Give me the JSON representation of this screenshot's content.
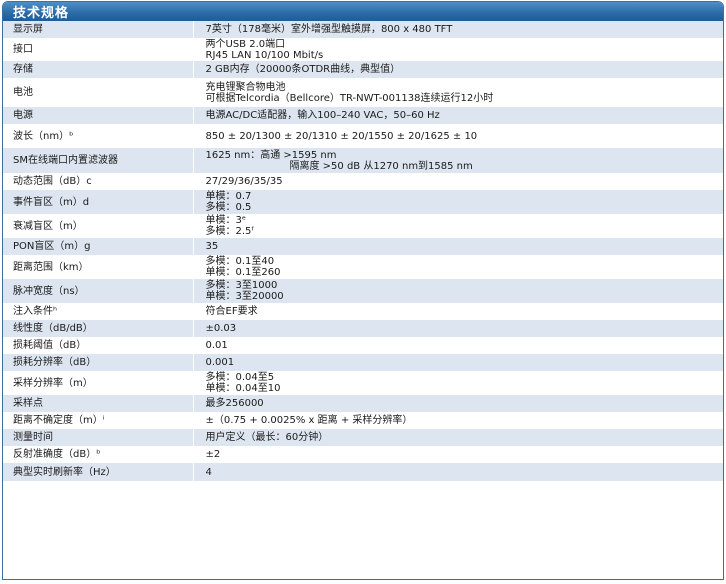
{
  "title": "技术规格",
  "rows": [
    {
      "label": "显示屏",
      "lines": [
        "7英寸（178毫米）室外增强型触摸屏，800 x 480 TFT"
      ]
    },
    {
      "label": "接口",
      "lines": [
        "两个USB 2.0端口",
        "RJ45 LAN 10/100 Mbit/s"
      ]
    },
    {
      "label": "存储",
      "lines": [
        "2 GB内存（20000条OTDR曲线，典型值）"
      ]
    },
    {
      "label": "电池",
      "lines": [
        "充电锂聚合物电池",
        "可根据Telcordia（Bellcore）TR-NWT-001138连续运行12小时"
      ]
    },
    {
      "label": "电源",
      "lines": [
        "电源AC/DC适配器，输入100–240 VAC，50–60 Hz"
      ]
    },
    {
      "label": "波长（nm）ᵇ",
      "lines": [
        "850 ± 20/1300 ± 20/1310 ± 20/1550 ± 20/1625 ± 10"
      ]
    },
    {
      "label": "SM在线端口内置滤波器",
      "lines": [
        "1625 nm：高通 >1595 nm",
        "隔离度 >50 dB 从1270 nm到1585 nm"
      ]
    },
    {
      "label": "动态范围（dB）c",
      "lines": [
        "27/29/36/35/35"
      ]
    },
    {
      "label": "事件盲区（m）d",
      "lines": [
        "单模：0.7",
        "多模：0.5"
      ]
    },
    {
      "label": "衰减盲区（m）",
      "lines": [
        "单模：3ᵉ",
        "多模：2.5ᶠ"
      ]
    },
    {
      "label": "PON盲区（m）g",
      "lines": [
        "35"
      ]
    },
    {
      "label": "距离范围（km）",
      "lines": [
        "多模：0.1至40",
        "单模：0.1至260"
      ]
    },
    {
      "label": "脉冲宽度（ns）",
      "lines": [
        "多模：3至1000",
        "单模：3至20000"
      ]
    },
    {
      "label": "注入条件ʰ",
      "lines": [
        "符合EF要求"
      ]
    },
    {
      "label": "线性度（dB/dB）",
      "lines": [
        "±0.03"
      ]
    },
    {
      "label": "损耗阈值（dB）",
      "lines": [
        "0.01"
      ]
    },
    {
      "label": "损耗分辨率（dB）",
      "lines": [
        "0.001"
      ]
    },
    {
      "label": "采样分辨率（m）",
      "lines": [
        "多模：0.04至5",
        "单模：0.04至10"
      ]
    },
    {
      "label": "采样点",
      "lines": [
        "最多256000"
      ]
    },
    {
      "label": "距离不确定度（m）ⁱ",
      "lines": [
        "±（0.75 + 0.0025% x 距离 + 采样分辨率）"
      ]
    },
    {
      "label": "测量时间",
      "lines": [
        "用户定义（最长：60分钟）"
      ]
    },
    {
      "label": "反射准确度（dB）ᵇ",
      "lines": [
        "±2"
      ]
    },
    {
      "label": "典型实时刷新率（Hz）",
      "lines": [
        "4"
      ]
    }
  ]
}
